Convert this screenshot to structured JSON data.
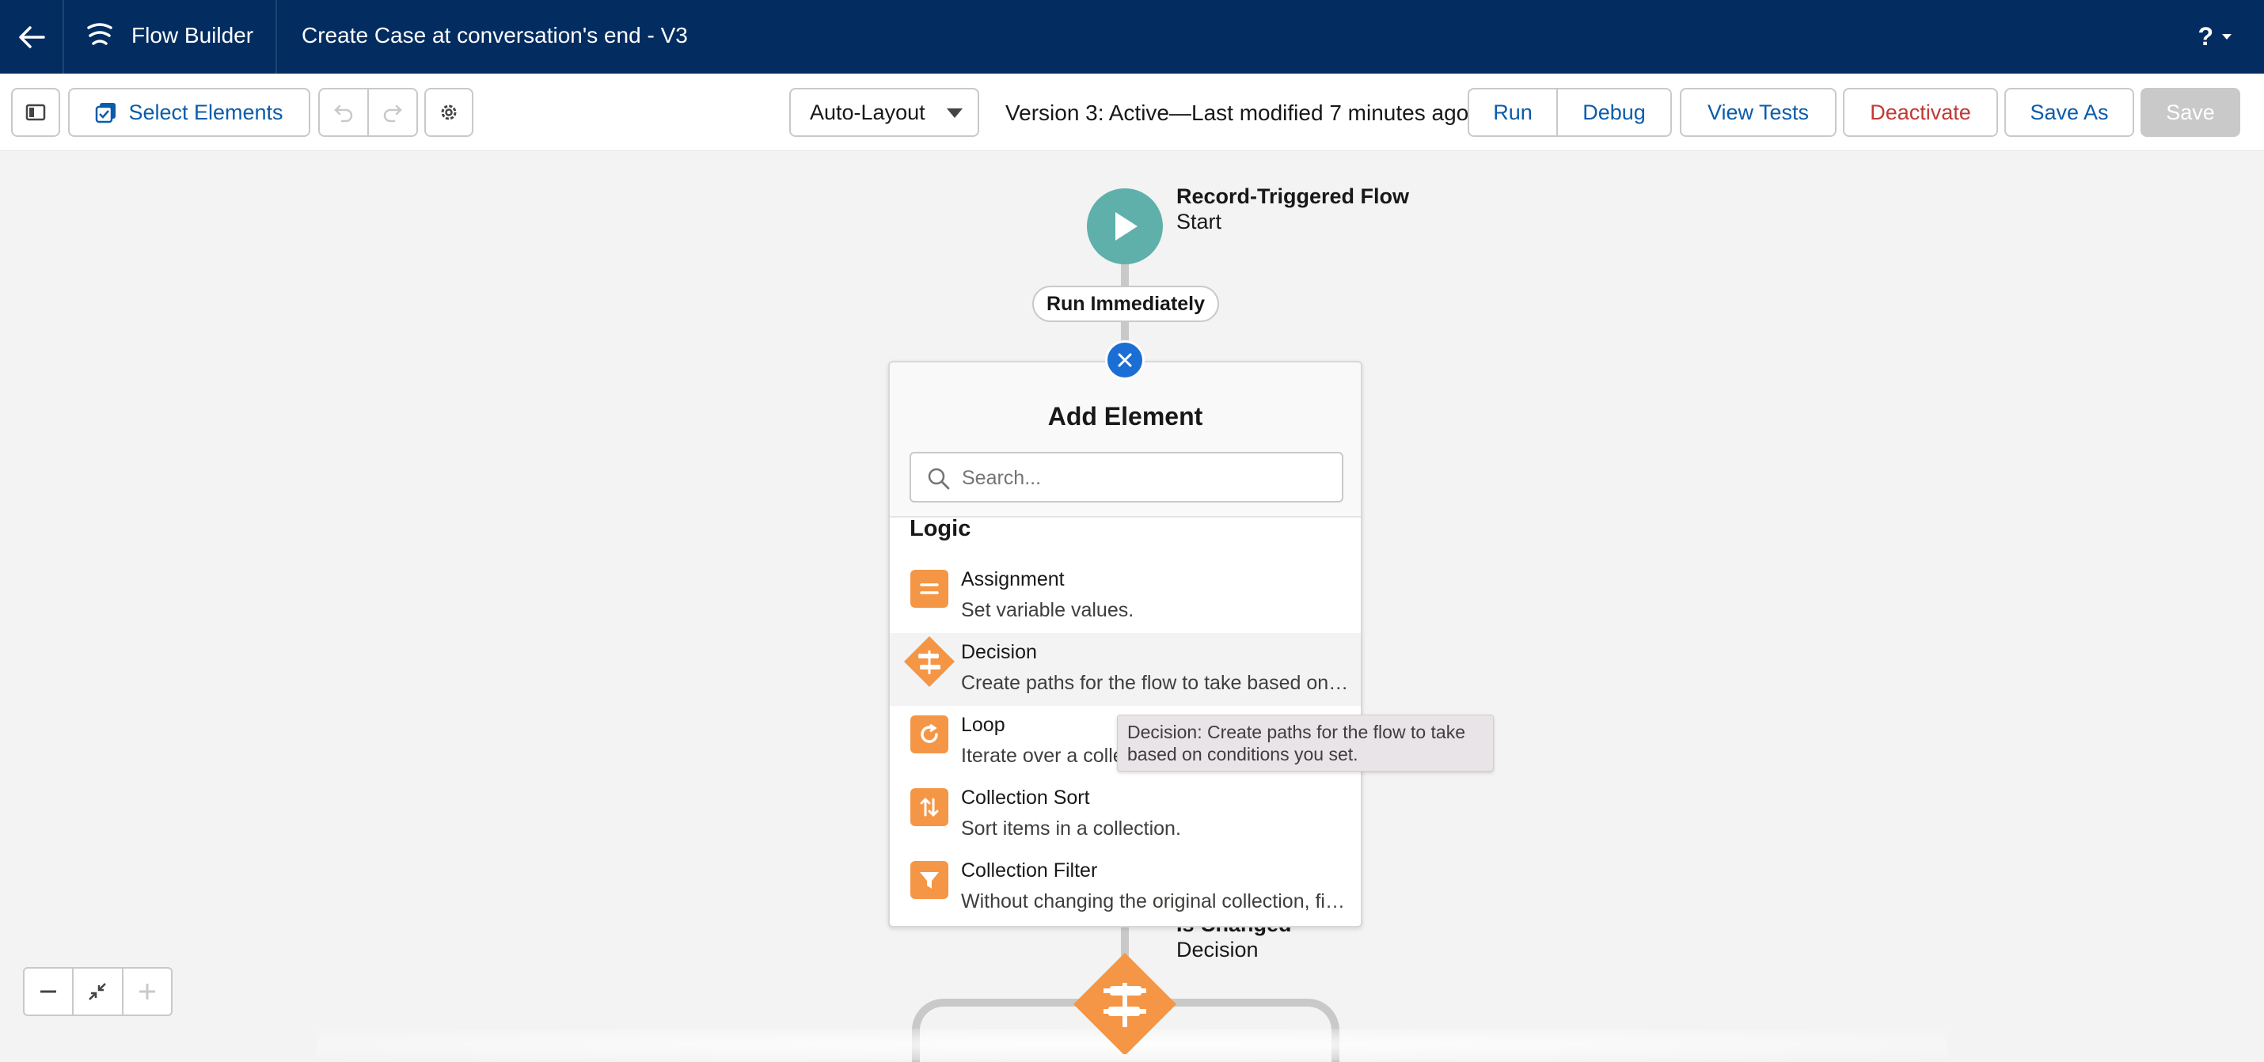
{
  "header": {
    "app_name": "Flow Builder",
    "flow_title": "Create Case at conversation's end - V3",
    "help_label": "?"
  },
  "toolbar": {
    "select_elements": "Select Elements",
    "layout_select": "Auto-Layout",
    "version_text": "Version 3: Active—Last modified 7 minutes ago",
    "run": "Run",
    "debug": "Debug",
    "view_tests": "View Tests",
    "deactivate": "Deactivate",
    "save_as": "Save As",
    "save": "Save"
  },
  "canvas": {
    "start_node": {
      "title": "Record-Triggered Flow",
      "subtitle": "Start"
    },
    "run_pill": "Run Immediately",
    "decision_node": {
      "title_partial": "Is Changed",
      "subtitle": "Decision"
    }
  },
  "add_element": {
    "title": "Add Element",
    "search_placeholder": "Search...",
    "section": "Logic",
    "items": [
      {
        "name": "Assignment",
        "desc": "Set variable values.",
        "icon": "assignment-icon"
      },
      {
        "name": "Decision",
        "desc": "Create paths for the flow to take based on conditions you set.",
        "icon": "decision-icon"
      },
      {
        "name": "Loop",
        "desc": "Iterate over a collection",
        "icon": "loop-icon"
      },
      {
        "name": "Collection Sort",
        "desc": "Sort items in a collection.",
        "icon": "collection-sort-icon"
      },
      {
        "name": "Collection Filter",
        "desc": "Without changing the original collection, filter items",
        "icon": "collection-filter-icon"
      }
    ],
    "tooltip": "Decision: Create paths for the flow to take based on conditions you set."
  },
  "colors": {
    "header_bg": "#032d60",
    "accent_blue": "#0b5cab",
    "danger_red": "#c23934",
    "start_teal": "#5fb0aa",
    "logic_orange": "#f49645"
  }
}
